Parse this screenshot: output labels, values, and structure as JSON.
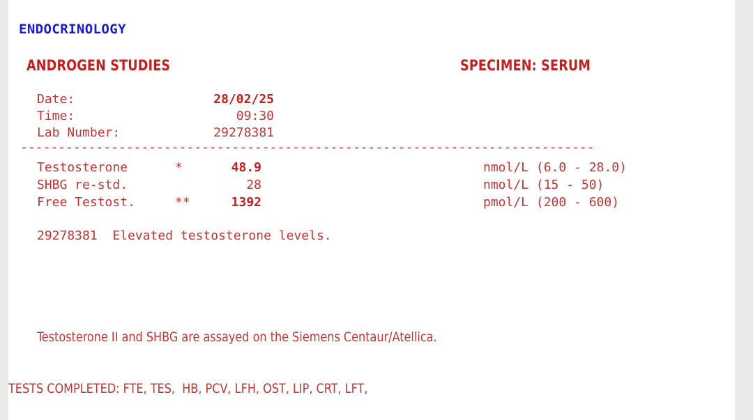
{
  "report": {
    "department": "ENDOCRINOLOGY",
    "panel_title": "ANDROGEN STUDIES",
    "specimen": "SPECIMEN: SERUM",
    "separator": "----------------------------------------------------------------------------",
    "meta": [
      {
        "label": "Date:",
        "value": "28/02/25",
        "bold": true
      },
      {
        "label": "Time:",
        "value": "09:30",
        "bold": false
      },
      {
        "label": "Lab Number:",
        "value": "29278381",
        "bold": false
      }
    ],
    "results": [
      {
        "analyte": "Testosterone",
        "flag": "*",
        "value": "48.9",
        "abnormal": true,
        "units": "nmol/L (6.0 - 28.0)"
      },
      {
        "analyte": "SHBG re-std.",
        "flag": "",
        "value": "28",
        "abnormal": false,
        "units": "nmol/L (15 - 50)"
      },
      {
        "analyte": "Free Testost.",
        "flag": "**",
        "value": "1392",
        "abnormal": true,
        "units": "pmol/L (200 - 600)"
      }
    ],
    "comment": "29278381  Elevated testosterone levels.",
    "assay_note": "Testosterone II and SHBG are assayed on the Siemens Centaur/Atellica.",
    "tests_completed": "TESTS COMPLETED: FTE, TES,  HB, PCV, LFH, OST, LIP, CRT, LFT,"
  },
  "colors": {
    "heading_blue": "#1a1ac8",
    "text_red": "#c43434",
    "bold_red": "#c0201f",
    "page_background": "#ffffff",
    "gutter_background": "#eaeaea"
  }
}
